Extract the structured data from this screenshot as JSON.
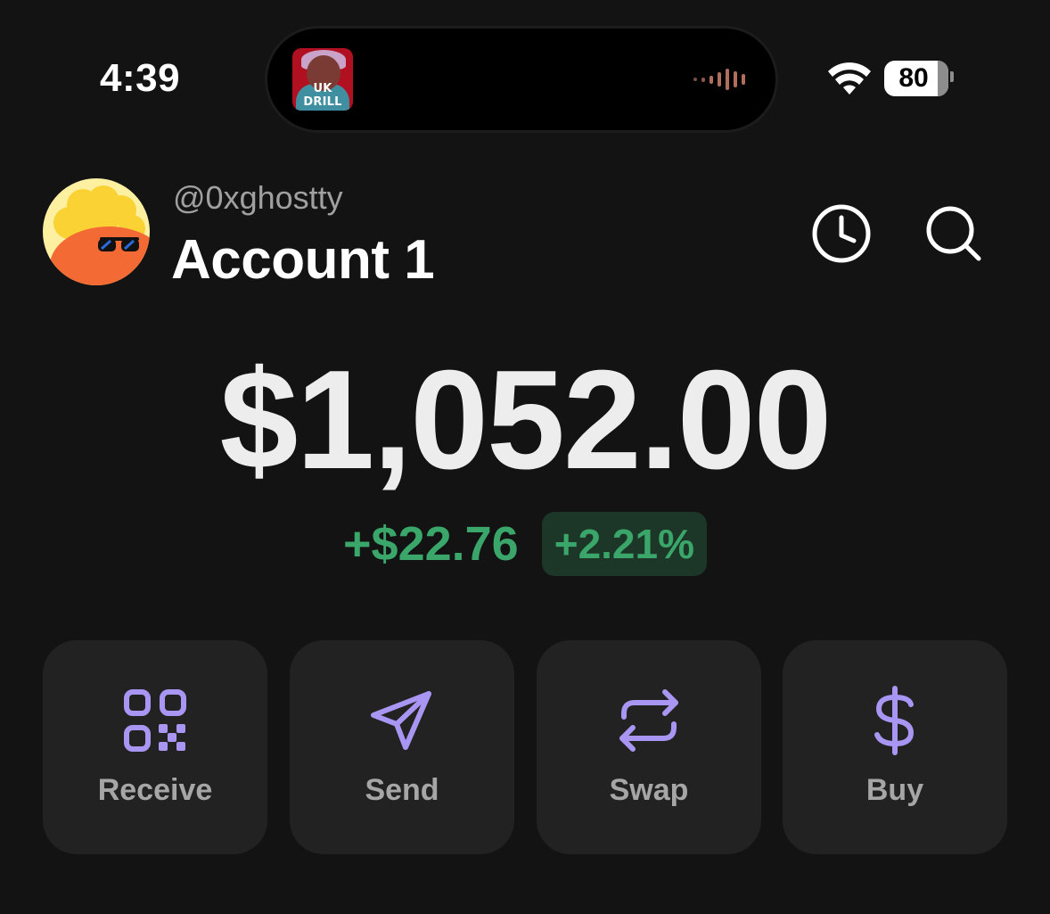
{
  "status_bar": {
    "time": "4:39",
    "battery_level": "80",
    "now_playing_art_text": "UK DRILL",
    "icons": [
      "album-art",
      "waveform-icon",
      "wifi-icon",
      "battery-icon"
    ]
  },
  "account": {
    "username": "@0xghostty",
    "name": "Account 1",
    "icons": [
      "history-icon",
      "search-icon"
    ]
  },
  "balance": {
    "total": "$1,052.00",
    "change_amount": "+$22.76",
    "change_percent": "+2.21%"
  },
  "actions": [
    {
      "label": "Receive",
      "icon": "qr-code-icon"
    },
    {
      "label": "Send",
      "icon": "send-icon"
    },
    {
      "label": "Swap",
      "icon": "swap-icon"
    },
    {
      "label": "Buy",
      "icon": "dollar-icon"
    }
  ],
  "colors": {
    "background": "#131313",
    "positive": "#3aa66a",
    "positive_bg": "#1c3627",
    "accent": "#a996f2",
    "button_bg": "#222222"
  }
}
